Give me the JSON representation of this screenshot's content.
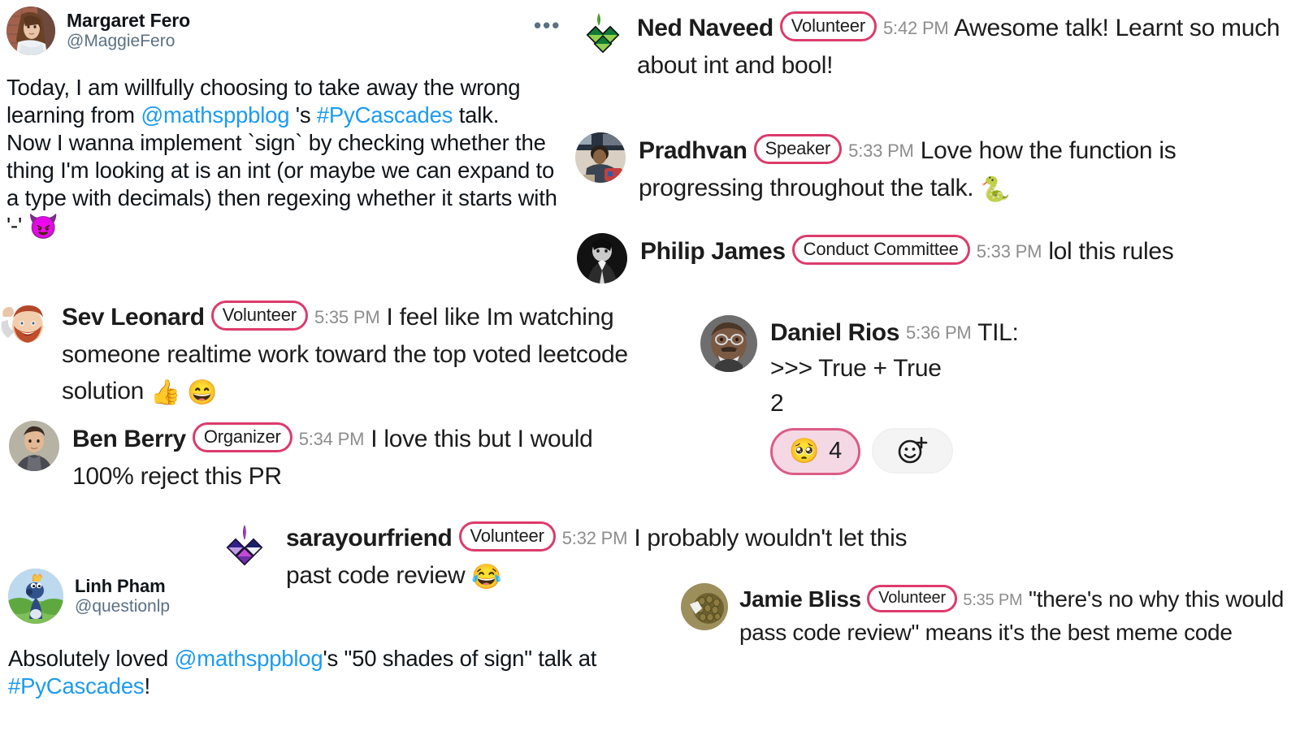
{
  "colors": {
    "background": "#ffffff",
    "link": "#1d9bf0",
    "badge_border": "#dc3b6b",
    "timestamp": "#8d8d8d",
    "handle": "#5b7083",
    "text": "#0f1419",
    "reaction_fill": "#f4d9e4",
    "reaction_border": "#dc5b87"
  },
  "tweets": [
    {
      "id": "margaret-fero",
      "display_name": "Margaret Fero",
      "handle": "@MaggieFero",
      "avatar_name": "avatar-margaret-fero",
      "more_icon": "more-options-icon",
      "more_label": "•••",
      "body_segments": [
        {
          "type": "text",
          "text": "Today, I am willfully choosing to take away the wrong learning from "
        },
        {
          "type": "link",
          "text": "@mathsppblog"
        },
        {
          "type": "text",
          "text": " 's "
        },
        {
          "type": "link",
          "text": "#PyCascades"
        },
        {
          "type": "text",
          "text": " talk."
        },
        {
          "type": "break"
        },
        {
          "type": "text",
          "text": "Now I wanna implement `sign` by checking whether the thing I'm looking at is an int (or maybe we can expand to a type with decimals) then regexing whether it starts with '-' "
        },
        {
          "type": "emoji",
          "text": "😈"
        }
      ]
    },
    {
      "id": "linh-pham",
      "display_name": "Linh Pham",
      "handle": "@questionlp",
      "avatar_name": "avatar-linh-pham",
      "body_segments": [
        {
          "type": "text",
          "text": "Absolutely loved "
        },
        {
          "type": "link",
          "text": "@mathsppblog"
        },
        {
          "type": "text",
          "text": "'s \"50 shades of sign\" talk at "
        },
        {
          "type": "link",
          "text": "#PyCascades"
        },
        {
          "type": "text",
          "text": "!"
        }
      ]
    }
  ],
  "messages": [
    {
      "id": "ned-naveed",
      "name": "Ned Naveed",
      "badge": "Volunteer",
      "time": "5:42 PM",
      "avatar_name": "avatar-ned-naveed",
      "text": "Awesome talk! Learnt so much about int and bool!"
    },
    {
      "id": "pradhvan",
      "name": "Pradhvan",
      "badge": "Speaker",
      "time": "5:33 PM",
      "avatar_name": "avatar-pradhvan",
      "text": "Love how the function is progressing throughout the talk.",
      "trailing_emoji": "🐍"
    },
    {
      "id": "philip-james",
      "name": "Philip James",
      "badge": "Conduct Committee",
      "time": "5:33 PM",
      "avatar_name": "avatar-philip-james",
      "text": "lol this rules"
    },
    {
      "id": "sev-leonard",
      "name": "Sev Leonard",
      "badge": "Volunteer",
      "time": "5:35 PM",
      "avatar_name": "avatar-sev-leonard",
      "text": "I feel like Im watching someone realtime work toward the top voted leetcode solution",
      "trailing_emoji": "👍 😄"
    },
    {
      "id": "ben-berry",
      "name": "Ben Berry",
      "badge": "Organizer",
      "time": "5:34 PM",
      "avatar_name": "avatar-ben-berry",
      "text": "I love this but I would 100% reject this PR"
    },
    {
      "id": "daniel-rios",
      "name": "Daniel Rios",
      "badge": null,
      "time": "5:36 PM",
      "avatar_name": "avatar-daniel-rios",
      "text_lines": [
        "TIL:",
        ">>> True + True",
        "2"
      ],
      "reactions": [
        {
          "emoji": "🥺",
          "emoji_name": "flushed-pleading-face-emoji",
          "count": "4"
        }
      ],
      "add_reaction_label": "add-reaction"
    },
    {
      "id": "sarayourfriend",
      "name": "sarayourfriend",
      "badge": "Volunteer",
      "time": "5:32 PM",
      "avatar_name": "avatar-sarayourfriend",
      "text": "I probably wouldn't let this past code review",
      "trailing_emoji": "😂"
    },
    {
      "id": "jamie-bliss",
      "name": "Jamie Bliss",
      "badge": "Volunteer",
      "time": "5:35 PM",
      "avatar_name": "avatar-jamie-bliss",
      "text": "\"there's no why this would pass code review\" means it's the best meme code"
    }
  ]
}
